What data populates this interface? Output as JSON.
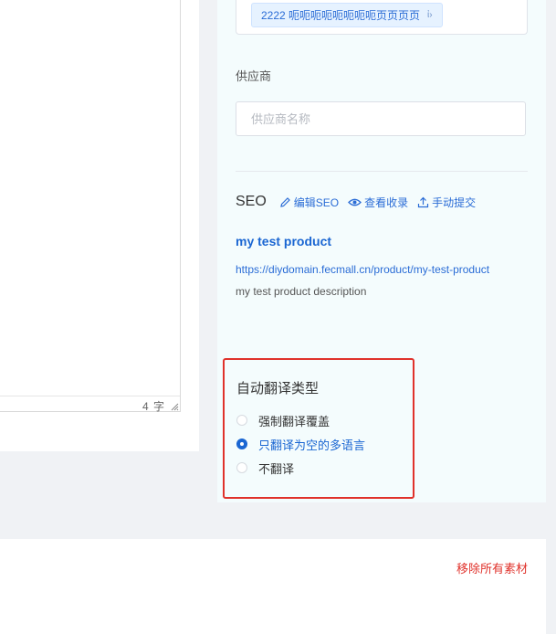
{
  "editor": {
    "word_count": "4 字"
  },
  "tags": [
    {
      "label": "2222 呃呃呃呃呃呃呃呃页页页页"
    }
  ],
  "supplier": {
    "label": "供应商",
    "placeholder": "供应商名称",
    "value": ""
  },
  "seo": {
    "title": "SEO",
    "actions": [
      {
        "label": "编辑SEO",
        "icon": "pencil-icon"
      },
      {
        "label": "查看收录",
        "icon": "eye-icon"
      },
      {
        "label": "手动提交",
        "icon": "upload-icon"
      }
    ],
    "preview": {
      "product_title": "my test product",
      "url": "https://diydomain.fecmall.cn/product/my-test-product",
      "description": "my test product description"
    }
  },
  "auto_translate": {
    "title": "自动翻译类型",
    "options": [
      {
        "label": "强制翻译覆盖",
        "checked": false
      },
      {
        "label": "只翻译为空的多语言",
        "checked": true
      },
      {
        "label": "不翻译",
        "checked": false
      }
    ]
  },
  "footer": {
    "remove_all_label": "移除所有素材"
  },
  "colors": {
    "accent": "#1a66d2",
    "danger": "#e0322b",
    "panel_bg": "#f4fcfd"
  }
}
